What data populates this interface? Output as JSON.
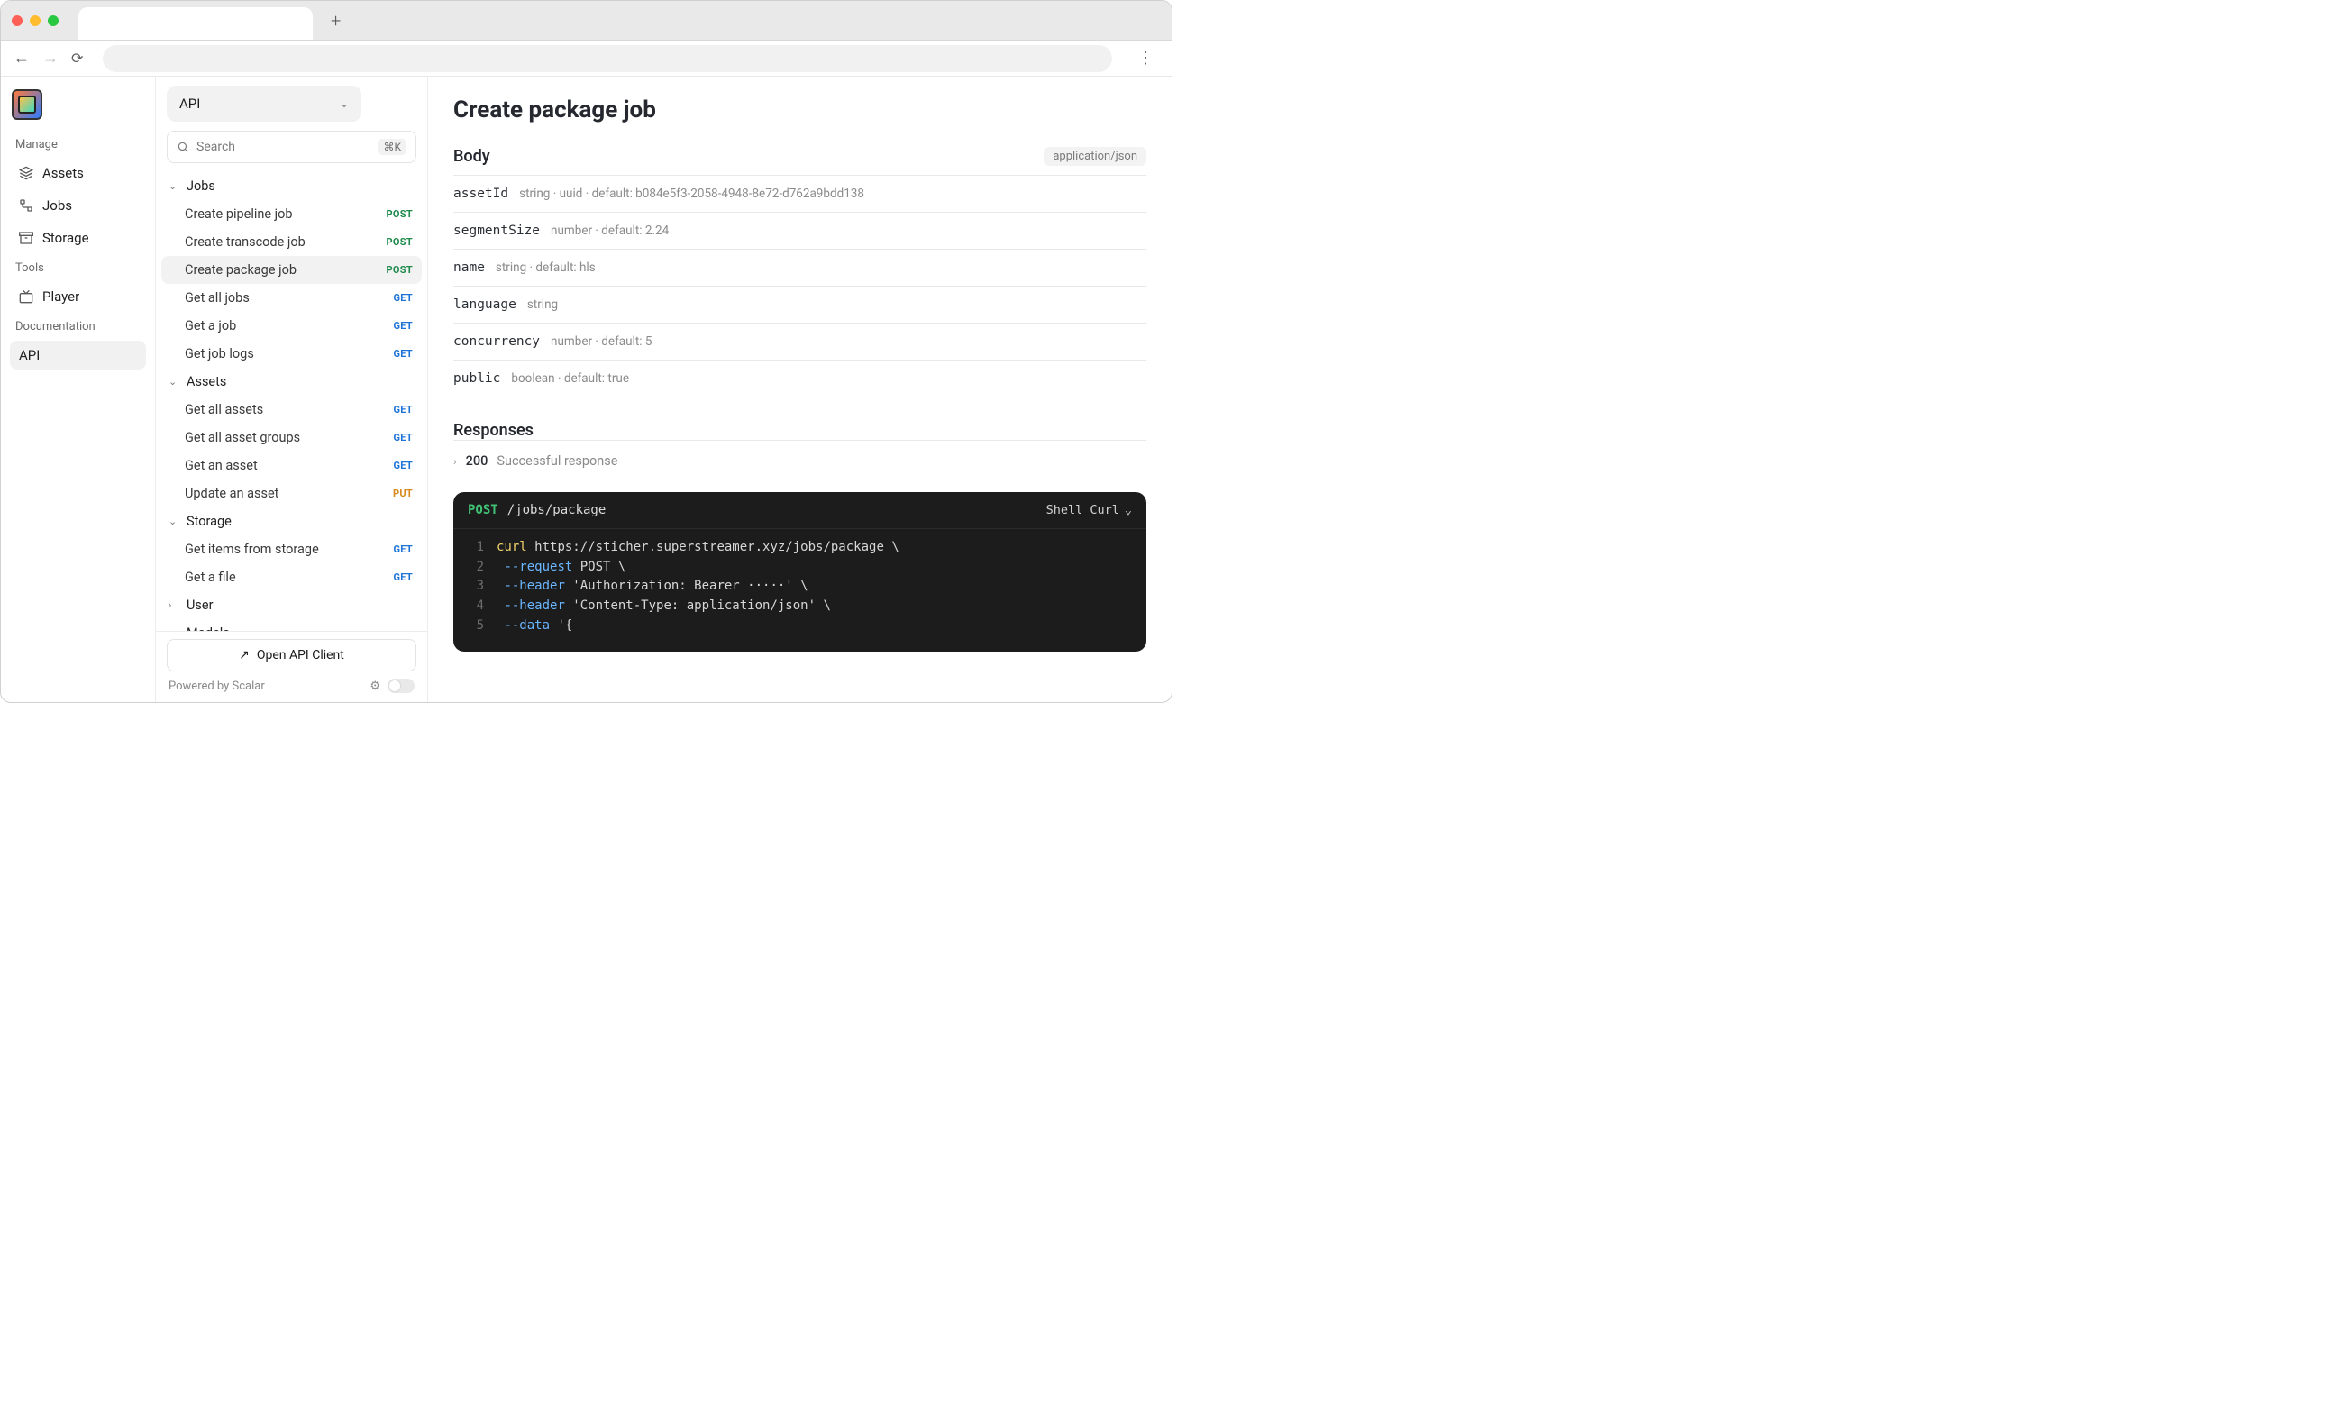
{
  "leftNav": {
    "sectionManage": "Manage",
    "sectionTools": "Tools",
    "sectionDocs": "Documentation",
    "assets": "Assets",
    "jobs": "Jobs",
    "storage": "Storage",
    "player": "Player",
    "api": "API"
  },
  "midCol": {
    "dropdown": "API",
    "search_placeholder": "Search",
    "search_kbd": "⌘K",
    "open_client": "Open API Client",
    "powered": "Powered by Scalar"
  },
  "tree": {
    "groups": [
      {
        "name": "Jobs",
        "expanded": true,
        "items": [
          {
            "label": "Create pipeline job",
            "method": "POST"
          },
          {
            "label": "Create transcode job",
            "method": "POST"
          },
          {
            "label": "Create package job",
            "method": "POST",
            "active": true
          },
          {
            "label": "Get all jobs",
            "method": "GET"
          },
          {
            "label": "Get a job",
            "method": "GET"
          },
          {
            "label": "Get job logs",
            "method": "GET"
          }
        ]
      },
      {
        "name": "Assets",
        "expanded": true,
        "items": [
          {
            "label": "Get all assets",
            "method": "GET"
          },
          {
            "label": "Get all asset groups",
            "method": "GET"
          },
          {
            "label": "Get an asset",
            "method": "GET"
          },
          {
            "label": "Update an asset",
            "method": "PUT"
          }
        ]
      },
      {
        "name": "Storage",
        "expanded": true,
        "items": [
          {
            "label": "Get items from storage",
            "method": "GET"
          },
          {
            "label": "Get a file",
            "method": "GET"
          }
        ]
      },
      {
        "name": "User",
        "expanded": false,
        "items": []
      },
      {
        "name": "Models",
        "expanded": false,
        "items": []
      }
    ]
  },
  "main": {
    "title": "Create package job",
    "body_label": "Body",
    "content_type": "application/json",
    "responses_label": "Responses",
    "params": [
      {
        "name": "assetId",
        "meta": "string · uuid · default: b084e5f3-2058-4948-8e72-d762a9bdd138"
      },
      {
        "name": "segmentSize",
        "meta": "number · default: 2.24"
      },
      {
        "name": "name",
        "meta": "string · default: hls"
      },
      {
        "name": "language",
        "meta": "string"
      },
      {
        "name": "concurrency",
        "meta": "number · default: 5"
      },
      {
        "name": "public",
        "meta": "boolean · default: true"
      }
    ],
    "response": {
      "code": "200",
      "desc": "Successful response"
    },
    "code": {
      "method": "POST",
      "path": "/jobs/package",
      "lang": "Shell Curl",
      "lines": [
        {
          "n": "1",
          "segs": [
            {
              "t": "curl ",
              "c": "cmd"
            },
            {
              "t": "https://sticher.superstreamer.xyz/jobs/package ",
              "c": "url"
            },
            {
              "t": "\\",
              "c": "str"
            }
          ]
        },
        {
          "n": "2",
          "segs": [
            {
              "t": "  ",
              "c": ""
            },
            {
              "t": "--request ",
              "c": "flag"
            },
            {
              "t": "POST ",
              "c": "str"
            },
            {
              "t": "\\",
              "c": "str"
            }
          ]
        },
        {
          "n": "3",
          "segs": [
            {
              "t": "  ",
              "c": ""
            },
            {
              "t": "--header ",
              "c": "flag"
            },
            {
              "t": "'Authorization: Bearer ·····' ",
              "c": "str"
            },
            {
              "t": "\\",
              "c": "str"
            }
          ]
        },
        {
          "n": "4",
          "segs": [
            {
              "t": "  ",
              "c": ""
            },
            {
              "t": "--header ",
              "c": "flag"
            },
            {
              "t": "'Content-Type: application/json' ",
              "c": "str"
            },
            {
              "t": "\\",
              "c": "str"
            }
          ]
        },
        {
          "n": "5",
          "segs": [
            {
              "t": "  ",
              "c": ""
            },
            {
              "t": "--data ",
              "c": "flag"
            },
            {
              "t": "'{",
              "c": "str"
            }
          ]
        }
      ]
    }
  }
}
